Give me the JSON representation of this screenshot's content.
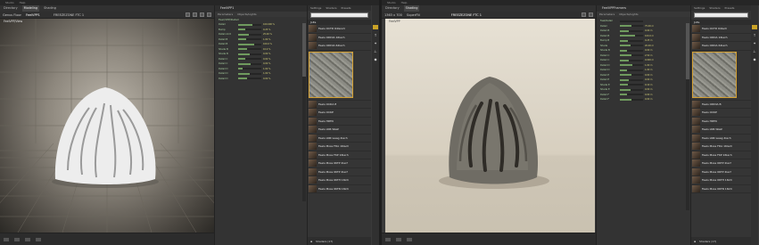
{
  "colors": {
    "accent": "#d4a032",
    "param_green": "#a9cfa0",
    "value_yellow": "#d7d27a"
  },
  "left": {
    "menu": [
      "Studio",
      "Help"
    ],
    "tabs": [
      "Directory",
      "Modeling",
      "Shading"
    ],
    "doc_label": "Genus Floor",
    "doc_name": "FeelVPP1",
    "doc_file": "FREEZEZONE FTC 1",
    "viewport_tag": "FeelVPP/View",
    "params_title": "FeelVPP1",
    "params_tabs": [
      "Parameters",
      "Objects/Lights"
    ],
    "params_section": "Feel/VPP/Detail",
    "params": [
      {
        "name": "Detail",
        "value": "100.000 %",
        "fill": 0.6
      },
      {
        "name": "Bump",
        "value": "0.25 %",
        "fill": 0.3
      },
      {
        "name": "Detail Amt",
        "value": "25.00 %",
        "fill": 0.45
      },
      {
        "name": "Detail B",
        "value": "1.00 %",
        "fill": 0.35
      },
      {
        "name": "Detail B",
        "value": "100.0 %",
        "fill": 0.7
      },
      {
        "name": "Shade B",
        "value": "10.0 %",
        "fill": 0.4
      },
      {
        "name": "Shade B",
        "value": "0.00 %",
        "fill": 0.5
      },
      {
        "name": "Detail C",
        "value": "0.00 %",
        "fill": 0.3
      },
      {
        "name": "Detail C",
        "value": "0.00 %",
        "fill": 0.55
      },
      {
        "name": "Detail D",
        "value": "1.00 %",
        "fill": 0.2
      },
      {
        "name": "Detail D",
        "value": "1.00 %",
        "fill": 0.5
      },
      {
        "name": "Detail D",
        "value": "0.00 %",
        "fill": 0.4
      }
    ],
    "browser_tabs": [
      "Settings",
      "Shaders",
      "Presets"
    ],
    "folder": "Jolts",
    "items": [
      "Feels OCTD 64lanch",
      "Feels ODDIA 16lach",
      "Feels ODDIA 64lach",
      "",
      "Feels OCDA B",
      "Feels OCKP",
      "Feels HRTN",
      "Feels LN6 Wash",
      "Feels LNR waag 4lach",
      "Feels Moss FDA 16lach",
      "Feels Moss FKP 16lach",
      "Feels Moss 0KTP 2lach",
      "Feels Moss 0KTP 4lach",
      "Feels Moss 0KTH 16lch",
      "Feels Moss 0KTN 16lch"
    ],
    "footer": "Shaders (17)"
  },
  "right": {
    "menu": [
      "Studio",
      "Help"
    ],
    "tabs": [
      "Directory",
      "Shading"
    ],
    "doc_label": "1363 x 700",
    "doc_name": "FREEZEZONE FTC 1",
    "camera_label": "SuperFN",
    "viewport_tag": "FeelVPP",
    "params_title": "FeelVPPFramers",
    "params_tabs": [
      "Parameters",
      "Objects/Lights"
    ],
    "params": [
      {
        "name": "Feel/Detail",
        "value": "",
        "fill": 0.0
      },
      {
        "name": "Detail",
        "value": "75.00 m",
        "fill": 0.5
      },
      {
        "name": "Detail B",
        "value": "0.00 m",
        "fill": 0.4
      },
      {
        "name": "Detail B",
        "value": "100.0 m",
        "fill": 0.65
      },
      {
        "name": "Bump B",
        "value": "0.25 m",
        "fill": 0.35
      },
      {
        "name": "Shade",
        "value": "20.00 m",
        "fill": 0.45
      },
      {
        "name": "Shade B",
        "value": "0.00 m",
        "fill": 0.3
      },
      {
        "name": "Detail C",
        "value": "2.50 m",
        "fill": 0.5
      },
      {
        "name": "Detail C",
        "value": "0.000 m",
        "fill": 0.4
      },
      {
        "name": "Detail D",
        "value": "1.00 m",
        "fill": 0.55
      },
      {
        "name": "Detail D",
        "value": "1.00 m",
        "fill": 0.3
      },
      {
        "name": "Detail E",
        "value": "0.00 m",
        "fill": 0.5
      },
      {
        "name": "Detail E",
        "value": "0.00 m",
        "fill": 0.4
      },
      {
        "name": "Shade E",
        "value": "0.10 m",
        "fill": 0.35
      },
      {
        "name": "Shade E",
        "value": "0.00 m",
        "fill": 0.45
      },
      {
        "name": "Detail F",
        "value": "0.00 m",
        "fill": 0.3
      },
      {
        "name": "Detail F",
        "value": "0.00 m",
        "fill": 0.5
      }
    ],
    "browser_tabs": [
      "Settings",
      "Shaders",
      "Presets"
    ],
    "folder": "Jolts",
    "items": [
      "Feels OCTD 64lach",
      "Feels ODDA 16lach",
      "Feels ODDA 64lach",
      "",
      "Feels ODDIA B",
      "Feels OCKP",
      "Feels HRTN",
      "Feels LN6 Wash",
      "Feels LNR waag 4lach",
      "Feels Moss FDA 16lach",
      "Feels Moss FKP 16lach",
      "Feels Moss 0KTP 2lach",
      "Feels Moss 0KTP 4lach",
      "Feels Moss 0KTH 16lch",
      "Feels Moss 0KTN 16lch"
    ],
    "footer": "Shaders (17)"
  }
}
